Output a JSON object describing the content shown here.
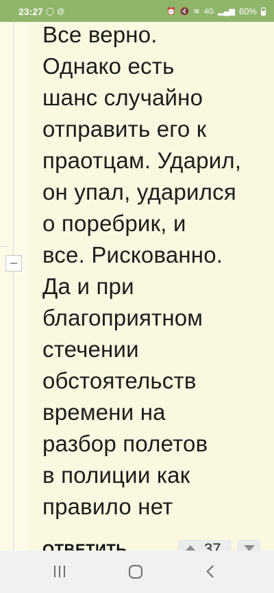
{
  "status_bar": {
    "time": "23:27",
    "battery": "60%",
    "network": "4G",
    "icons": [
      "whatsapp-icon",
      "at-icon",
      "alarm-icon",
      "mute-icon",
      "volte-icon",
      "signal-icon",
      "battery-icon"
    ]
  },
  "comment": {
    "lines": [
      "Все верно.",
      "Однако есть",
      "шанс случайно",
      "отправить его к",
      "праотцам. Ударил,",
      "он упал, ударился",
      "о поребрик, и",
      "все. Рискованно.",
      "Да и при",
      "благоприятном",
      "стечении",
      "обстоятельств",
      "времени на",
      "разбор полетов",
      "в полиции как",
      "правило нет"
    ],
    "reply_label": "ОТВЕТИТЬ",
    "votes": "37"
  },
  "colors": {
    "status_bar": "#8fb56a",
    "background": "#fbf8e1",
    "text": "#1c1c1c"
  }
}
